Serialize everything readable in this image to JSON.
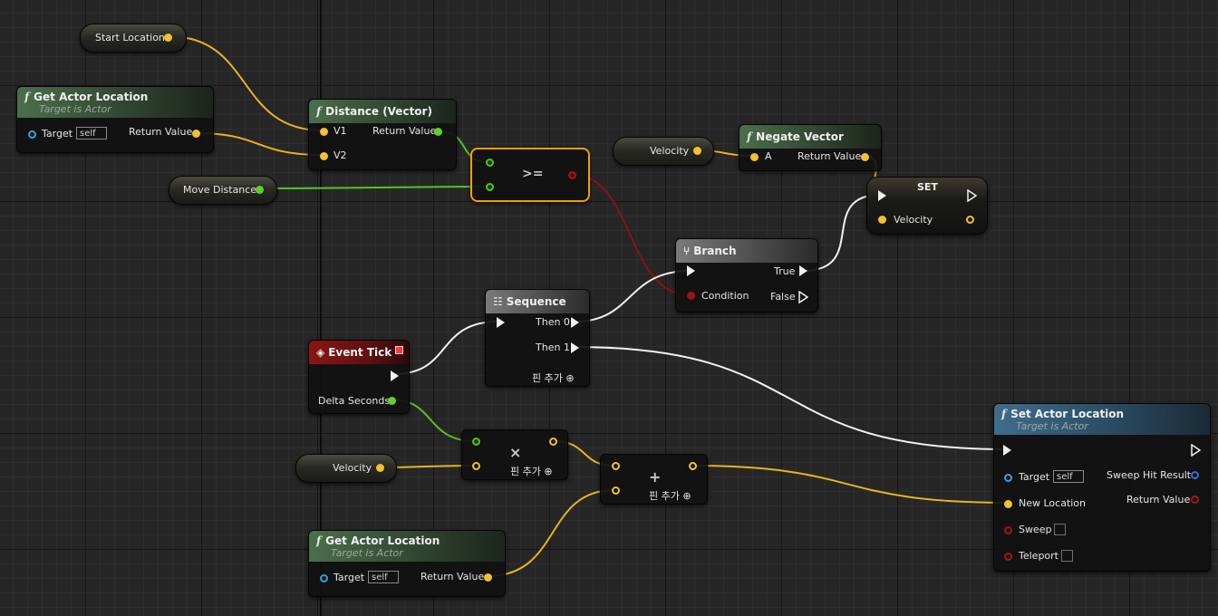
{
  "colors": {
    "background": "#262626",
    "exec_wire": "#ffffff",
    "vector_wire": "#f2c12c",
    "float_wire": "#5fd12a",
    "bool_wire": "#9e1212",
    "selected_border": "#f0a000"
  },
  "nodes": {
    "start_location": {
      "label": "Start Location"
    },
    "get_actor_location_1": {
      "title": "Get Actor Location",
      "subtitle": "Target is Actor",
      "target_label": "Target",
      "target_value": "self",
      "return_label": "Return Value"
    },
    "distance": {
      "title": "Distance (Vector)",
      "v1": "V1",
      "v2": "V2",
      "return_label": "Return Value"
    },
    "move_distance": {
      "label": "Move Distance"
    },
    "compare": {
      "op": ">="
    },
    "velocity_getter_top": {
      "label": "Velocity"
    },
    "negate_vector": {
      "title": "Negate Vector",
      "a": "A",
      "return_label": "Return Value"
    },
    "set_velocity": {
      "title": "SET",
      "velocity_label": "Velocity"
    },
    "branch": {
      "title": "Branch",
      "condition": "Condition",
      "true_label": "True",
      "false_label": "False"
    },
    "sequence": {
      "title": "Sequence",
      "then0": "Then 0",
      "then1": "Then 1",
      "add_pin": "핀 추가"
    },
    "event_tick": {
      "title": "Event Tick",
      "delta": "Delta Seconds"
    },
    "multiply": {
      "op": "×",
      "add_pin": "핀 추가"
    },
    "velocity_getter_bottom": {
      "label": "Velocity"
    },
    "add": {
      "op": "+",
      "add_pin": "핀 추가"
    },
    "get_actor_location_2": {
      "title": "Get Actor Location",
      "subtitle": "Target is Actor",
      "target_label": "Target",
      "target_value": "self",
      "return_label": "Return Value"
    },
    "set_actor_location": {
      "title": "Set Actor Location",
      "subtitle": "Target is Actor",
      "target_label": "Target",
      "target_value": "self",
      "new_location": "New Location",
      "sweep": "Sweep",
      "teleport": "Teleport",
      "sweep_hit": "Sweep Hit Result",
      "return_label": "Return Value"
    }
  },
  "icons": {
    "function": "function-icon",
    "branch": "branch-icon",
    "sequence": "sequence-icon",
    "event": "event-diamond-icon",
    "add_pin": "plus-circle-icon"
  }
}
